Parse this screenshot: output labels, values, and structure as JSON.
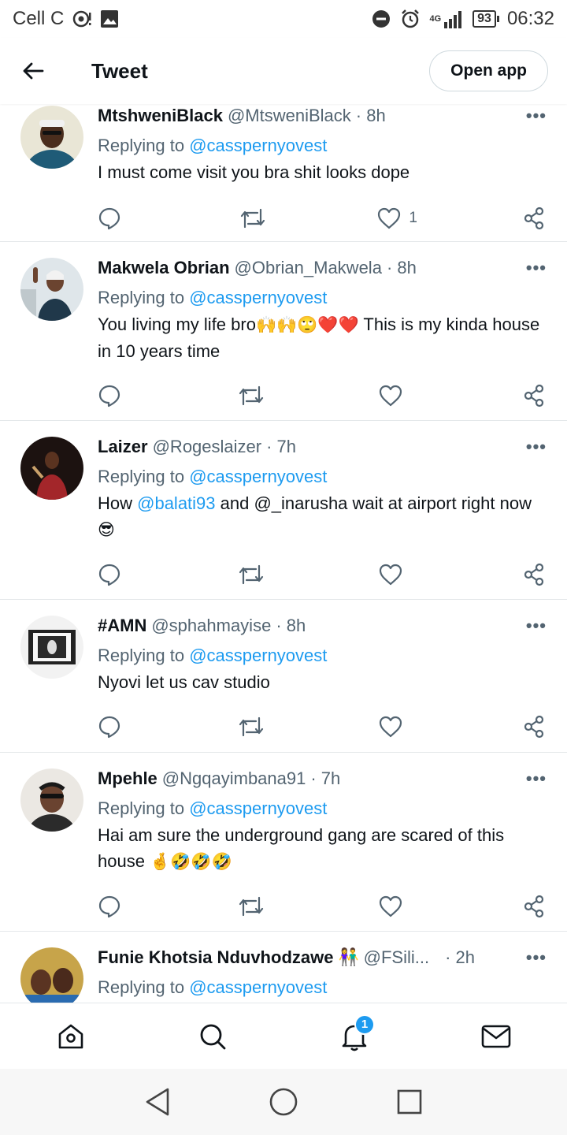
{
  "status_bar": {
    "carrier": "Cell C",
    "network_top": "4G",
    "battery": "93",
    "time": "06:32"
  },
  "header": {
    "title": "Tweet",
    "open_app_label": "Open app"
  },
  "tweets": [
    {
      "name": "MtshweniBlack",
      "handle": "@MtsweniBlack",
      "time": "· 8h",
      "more": "•••",
      "replying_prefix": "Replying to",
      "replying_to": "@casspernyovest",
      "text": "I must come visit you bra shit looks dope",
      "like_count": "1"
    },
    {
      "name": "Makwela Obrian",
      "handle": "@Obrian_Makwela",
      "time": "· 8h",
      "more": "•••",
      "replying_prefix": "Replying to",
      "replying_to": "@casspernyovest",
      "text_a": "You living my life bro",
      "emojis_a": "🙌🙌🙄❤️❤️",
      "text_b": " This is my kinda house in 10 years time",
      "like_count": ""
    },
    {
      "name": "Laizer",
      "handle": "@Rogeslaizer",
      "time": "· 7h",
      "more": "•••",
      "replying_prefix": "Replying to",
      "replying_to": "@casspernyovest",
      "text_a": "How ",
      "link": "@balati93",
      "text_b": " and @_inarusha wait at airport right now ",
      "emoji": "😎",
      "like_count": ""
    },
    {
      "name": "#AMN",
      "handle": "@sphahmayise",
      "time": "· 8h",
      "more": "•••",
      "replying_prefix": "Replying to",
      "replying_to": "@casspernyovest",
      "text": "Nyovi let us cav studio",
      "like_count": ""
    },
    {
      "name": "Mpehle",
      "handle": "@Ngqayimbana91",
      "time": "· 7h",
      "more": "•••",
      "replying_prefix": "Replying to",
      "replying_to": "@casspernyovest",
      "text": "Hai am sure the underground gang are scared of this house ",
      "emojis": "🤞🤣🤣🤣",
      "like_count": ""
    },
    {
      "name": "Funie Khotsia Nduvhodzawe",
      "name_emoji": "👫",
      "handle": "@FSili...",
      "time": "· 2h",
      "more": "•••",
      "replying_prefix": "Replying to",
      "replying_to": "@casspernyovest"
    }
  ],
  "tabbar": {
    "notif_badge": "1"
  },
  "icons": {
    "accent": "#1d9bf0",
    "muted": "#536471"
  }
}
